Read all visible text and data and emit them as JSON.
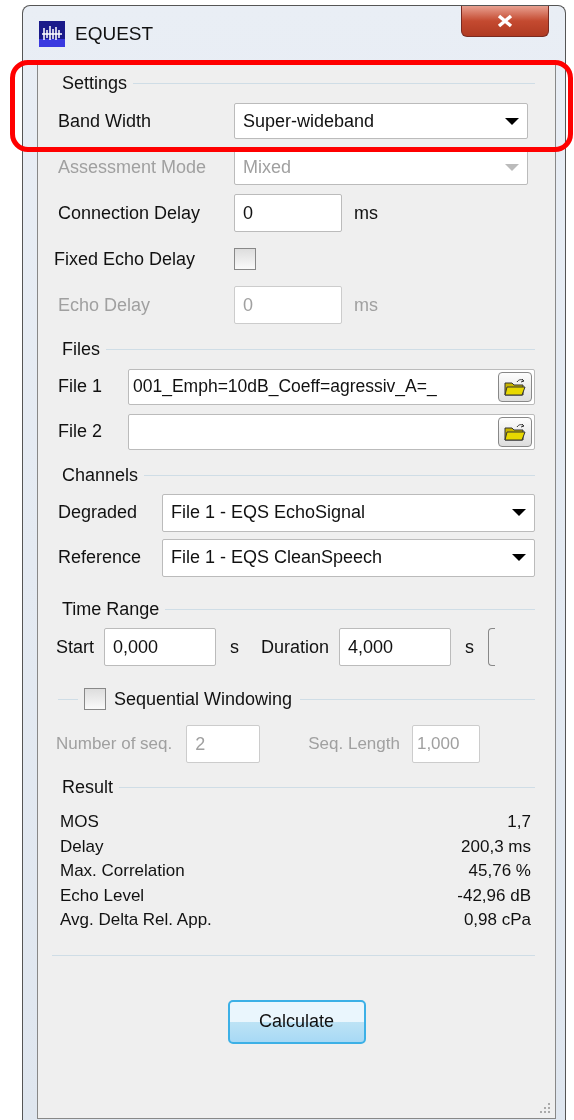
{
  "window": {
    "title": "EQUEST"
  },
  "settings": {
    "title": "Settings",
    "rows": [
      {
        "kind": "select",
        "label": "Band Width",
        "value": "Super-wideband",
        "disabled": false
      },
      {
        "kind": "select",
        "label": "Assessment Mode",
        "value": "Mixed",
        "disabled": true
      },
      {
        "kind": "input",
        "label": "Connection Delay",
        "value": "0",
        "unit": "ms",
        "disabled": false
      },
      {
        "kind": "checkbox",
        "label": "Fixed Echo Delay",
        "checked": false,
        "disabled": false
      },
      {
        "kind": "input",
        "label": "Echo Delay",
        "value": "0",
        "unit": "ms",
        "disabled": true
      }
    ]
  },
  "files": {
    "title": "Files",
    "rows": [
      {
        "label": "File 1",
        "value": "001_Emph=10dB_Coeff=agressiv_A=_"
      },
      {
        "label": "File 2",
        "value": ""
      }
    ]
  },
  "channels": {
    "title": "Channels",
    "rows": [
      {
        "label": "Degraded",
        "value": "File 1 - EQS EchoSignal"
      },
      {
        "label": "Reference",
        "value": "File 1 - EQS CleanSpeech"
      }
    ]
  },
  "time_range": {
    "title": "Time Range",
    "start": {
      "label": "Start",
      "value": "0,000",
      "unit": "s"
    },
    "duration": {
      "label": "Duration",
      "value": "4,000",
      "unit": "s"
    },
    "sequential": {
      "label": "Sequential Windowing",
      "checked": false
    },
    "number_of_seq": {
      "label": "Number of seq.",
      "value": "2",
      "disabled": true
    },
    "seq_length": {
      "label": "Seq. Length",
      "value": "1,000",
      "disabled": true
    }
  },
  "result": {
    "title": "Result",
    "rows": [
      {
        "label": "MOS",
        "value": "1,7"
      },
      {
        "label": "Delay",
        "value": "200,3 ms"
      },
      {
        "label": "Max. Correlation",
        "value": "45,76 %"
      },
      {
        "label": "Echo Level",
        "value": "-42,96 dB"
      },
      {
        "label": "Avg. Delta Rel. App.",
        "value": "0,98 cPa"
      }
    ]
  },
  "calculate_button": "Calculate"
}
